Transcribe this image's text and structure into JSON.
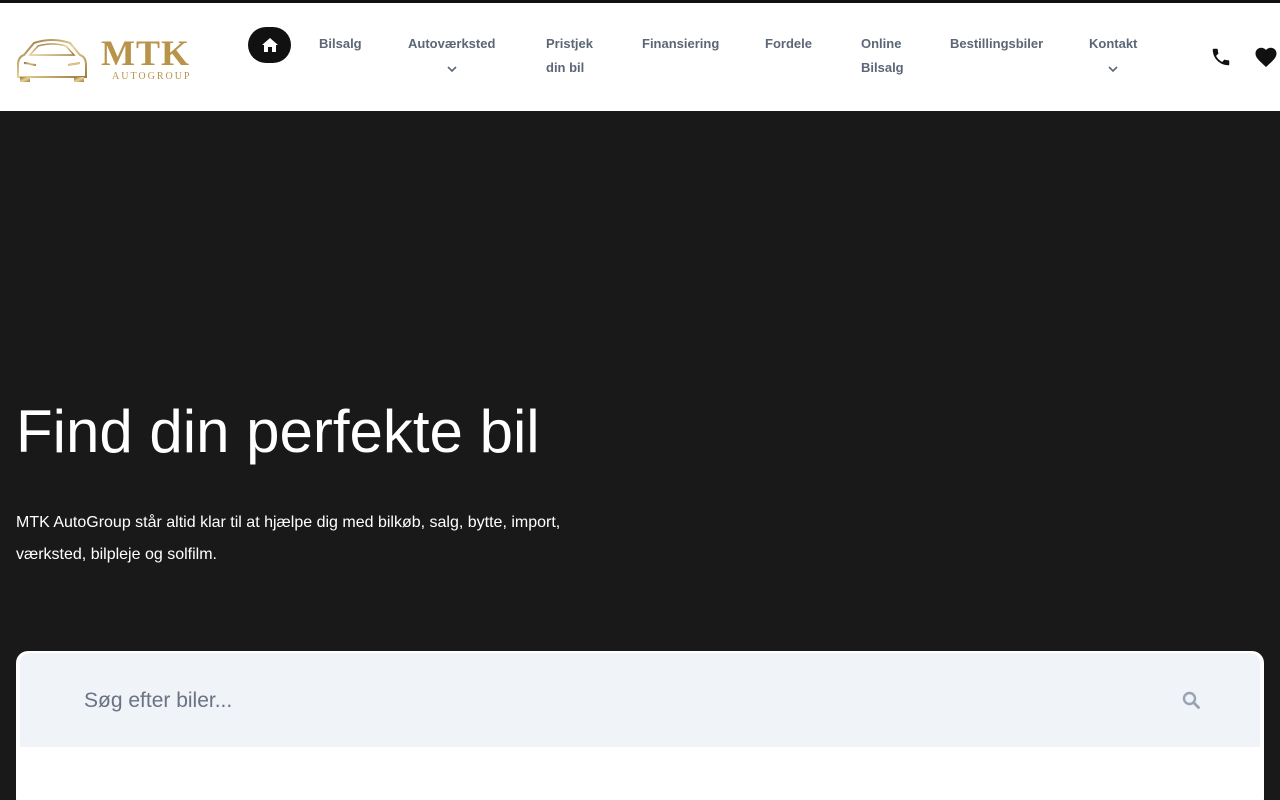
{
  "logo": {
    "brand": "MTK",
    "sub": "AUTOGROUP"
  },
  "nav": {
    "home_icon": "home-icon",
    "items": [
      {
        "label": "Bilsalg"
      },
      {
        "label": "Autoværksted",
        "has_dropdown": true
      },
      {
        "label": "Pristjek din bil"
      },
      {
        "label": "Finansiering"
      },
      {
        "label": "Fordele"
      },
      {
        "label": "Online Bilsalg"
      },
      {
        "label": "Bestillingsbiler"
      },
      {
        "label": "Kontakt",
        "has_dropdown": true
      }
    ],
    "phone_icon": "phone-icon",
    "favorites_icon": "heart-icon"
  },
  "hero": {
    "title": "Find din perfekte bil",
    "text": "MTK AutoGroup står altid klar til at hjælpe dig med bilkøb, salg, bytte, import, værksted, bilpleje og solfilm."
  },
  "search": {
    "placeholder": "Søg efter biler...",
    "value": ""
  },
  "colors": {
    "hero_bg": "#191919",
    "accent_gold": "#b8934a",
    "nav_text": "#5c6677",
    "search_bg": "#f0f3f8"
  }
}
